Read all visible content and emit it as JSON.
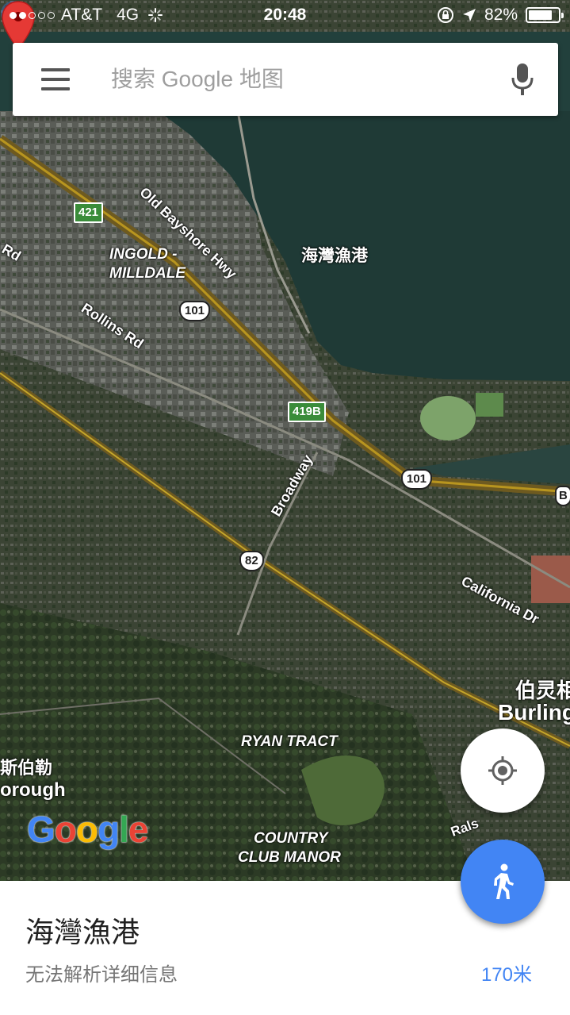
{
  "status_bar": {
    "carrier": "AT&T",
    "network": "4G",
    "time": "20:48",
    "battery": "82%",
    "battery_level": 0.82,
    "signal_bars_on": 2,
    "signal_bars_total": 5
  },
  "search": {
    "placeholder": "搜索 Google 地图"
  },
  "map": {
    "labels": {
      "old_bayshore": "Old Bayshore Hwy",
      "ingold": "INGOLD -",
      "milldale": "MILLDALE",
      "rollins": "Rollins Rd",
      "s_rd": "s Rd",
      "broadway": "Broadway",
      "california": "California Dr",
      "ryan_tract": "RYAN TRACT",
      "country": "COUNTRY",
      "club_manor": "CLUB MANOR",
      "burlingame_cn": "伯灵相",
      "burlingame": "Burling",
      "hillsborough_cn": "斯伯勒",
      "hillsborough": "orough",
      "rals": "Rals"
    },
    "shields": {
      "i421": "421",
      "us101_a": "101",
      "i419b": "419B",
      "us101_b": "101",
      "r82": "82",
      "b_edge": "B"
    },
    "pin_label": "海灣漁港"
  },
  "google_logo": {
    "letters": [
      "G",
      "o",
      "o",
      "g",
      "l",
      "e"
    ],
    "colors": [
      "#4285f4",
      "#ea4335",
      "#fbbc05",
      "#4285f4",
      "#34a853",
      "#ea4335"
    ]
  },
  "sheet": {
    "title": "海灣漁港",
    "subtitle": "无法解析详细信息",
    "distance": "170米"
  },
  "colors": {
    "accent": "#4285f4",
    "pin_red": "#e53935",
    "water": "#1f3a36"
  },
  "icons": [
    "menu-icon",
    "mic-icon",
    "map-pin-icon",
    "my-location-icon",
    "walk-icon",
    "location-arrow-icon",
    "rotation-lock-icon",
    "loading-spinner-icon"
  ]
}
